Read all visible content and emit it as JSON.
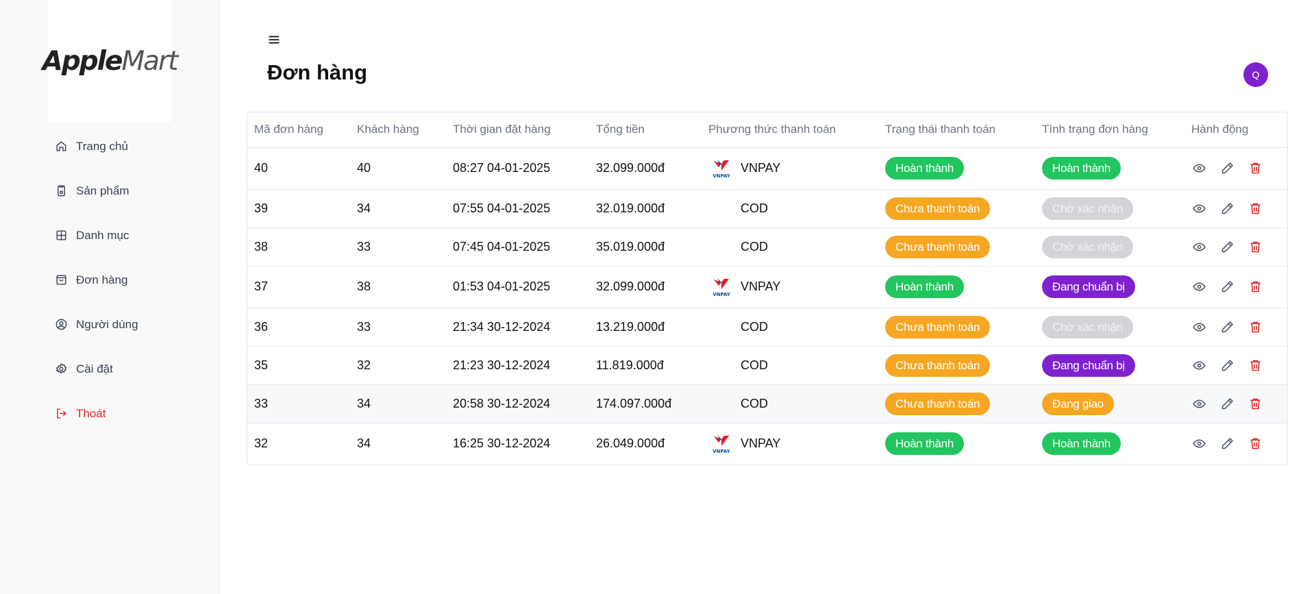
{
  "brand": {
    "name_part1": "Apple",
    "name_part2": "Mart"
  },
  "sidebar": {
    "items": [
      {
        "label": "Trang chủ",
        "icon": "home-icon"
      },
      {
        "label": "Sản phẩm",
        "icon": "phone-icon"
      },
      {
        "label": "Danh mục",
        "icon": "grid-icon"
      },
      {
        "label": "Đơn hàng",
        "icon": "shopping-bag-icon"
      },
      {
        "label": "Người dùng",
        "icon": "user-circle-icon"
      },
      {
        "label": "Cài đặt",
        "icon": "gear-icon"
      },
      {
        "label": "Thoát",
        "icon": "logout-icon"
      }
    ]
  },
  "header": {
    "title": "Đơn hàng",
    "avatar_initial": "Q"
  },
  "table": {
    "columns": [
      "Mã đơn hàng",
      "Khách hàng",
      "Thời gian đặt hàng",
      "Tổng tiền",
      "Phương thức thanh toán",
      "Trạng thái thanh toán",
      "Tình trạng đơn hàng",
      "Hành động"
    ],
    "vnpay_logo_text": "VNPAY",
    "rows": [
      {
        "id": "40",
        "customer": "40",
        "time": "08:27 04-01-2025",
        "total": "32.099.000đ",
        "method": "VNPAY",
        "pay_status": "Hoàn thành",
        "order_status": "Hoàn thành"
      },
      {
        "id": "39",
        "customer": "34",
        "time": "07:55 04-01-2025",
        "total": "32.019.000đ",
        "method": "COD",
        "pay_status": "Chưa thanh toán",
        "order_status": "Chờ xác nhận"
      },
      {
        "id": "38",
        "customer": "33",
        "time": "07:45 04-01-2025",
        "total": "35.019.000đ",
        "method": "COD",
        "pay_status": "Chưa thanh toán",
        "order_status": "Chờ xác nhận"
      },
      {
        "id": "37",
        "customer": "38",
        "time": "01:53 04-01-2025",
        "total": "32.099.000đ",
        "method": "VNPAY",
        "pay_status": "Hoàn thành",
        "order_status": "Đang chuẩn bị"
      },
      {
        "id": "36",
        "customer": "33",
        "time": "21:34 30-12-2024",
        "total": "13.219.000đ",
        "method": "COD",
        "pay_status": "Chưa thanh toán",
        "order_status": "Chờ xác nhận"
      },
      {
        "id": "35",
        "customer": "32",
        "time": "21:23 30-12-2024",
        "total": "11.819.000đ",
        "method": "COD",
        "pay_status": "Chưa thanh toán",
        "order_status": "Đang chuẩn bị"
      },
      {
        "id": "33",
        "customer": "34",
        "time": "20:58 30-12-2024",
        "total": "174.097.000đ",
        "method": "COD",
        "pay_status": "Chưa thanh toán",
        "order_status": "Đang giao"
      },
      {
        "id": "32",
        "customer": "34",
        "time": "16:25 30-12-2024",
        "total": "26.049.000đ",
        "method": "VNPAY",
        "pay_status": "Hoàn thành",
        "order_status": "Hoàn thành"
      }
    ]
  },
  "colors": {
    "green": "#22c55e",
    "orange": "#f5a623",
    "gray": "#d4d4d8",
    "purple": "#7e22ce",
    "danger": "#dc2626"
  }
}
